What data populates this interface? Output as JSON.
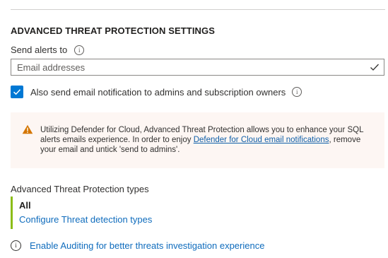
{
  "section": {
    "title": "ADVANCED THREAT PROTECTION SETTINGS"
  },
  "send_alerts": {
    "label": "Send alerts to",
    "info_icon": "info-icon",
    "placeholder": "Email addresses",
    "value": ""
  },
  "notify_admins": {
    "checked": true,
    "label": "Also send email notification to admins and subscription owners",
    "info_icon": "info-icon"
  },
  "warning": {
    "icon": "warning-icon",
    "text_before": "Utilizing Defender for Cloud, Advanced Threat Protection allows you to enhance your SQL alerts emails experience. In order to enjoy ",
    "link": "Defender for Cloud email notifications",
    "text_after": ", remove your email and untick 'send to admins'."
  },
  "atp_types": {
    "label": "Advanced Threat Protection types",
    "value": "All",
    "configure_link": "Configure Threat detection types"
  },
  "auditing": {
    "icon": "info-icon",
    "link": "Enable Auditing for better threats investigation experience"
  },
  "colors": {
    "accent_blue": "#0078d4",
    "link_blue": "#0f6cbd",
    "warning_bg": "#fdf6f3",
    "warning_icon": "#d47500",
    "types_bar": "#8cbd18"
  }
}
